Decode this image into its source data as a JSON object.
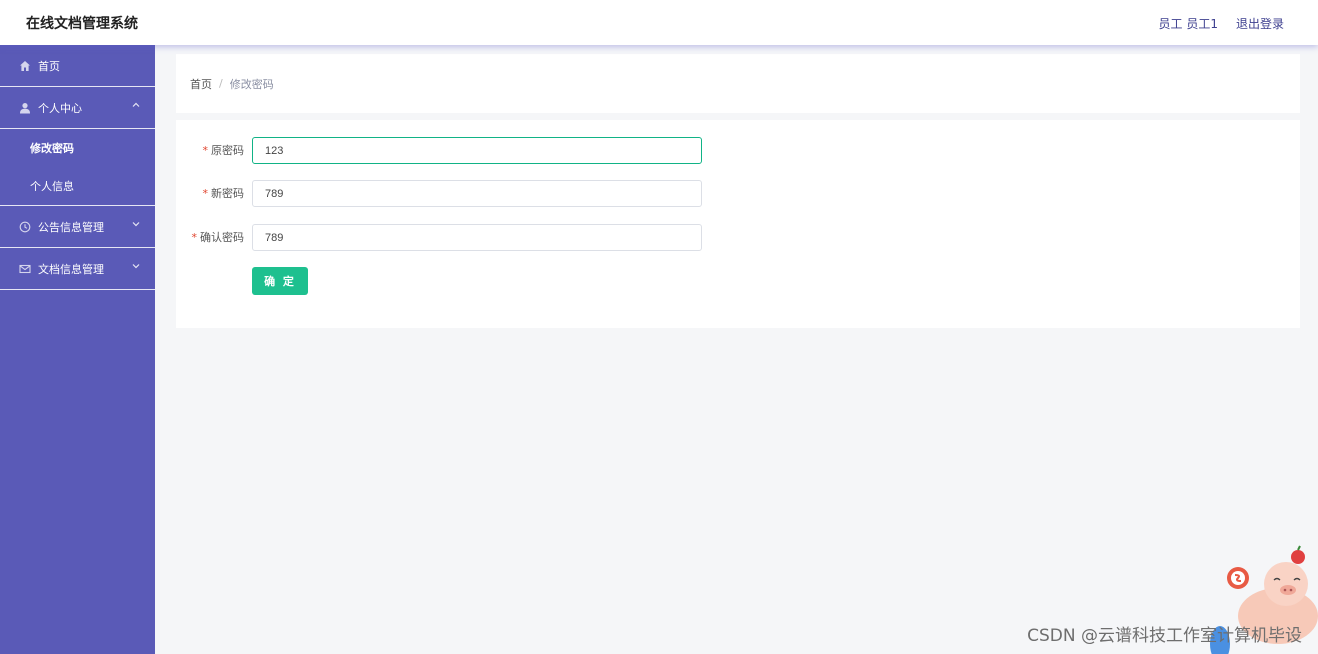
{
  "header": {
    "app_title": "在线文档管理系统",
    "user_label": "员工 员工1",
    "logout_label": "退出登录"
  },
  "sidebar": {
    "home": {
      "label": "首页",
      "icon": "home-icon"
    },
    "personal_center": {
      "label": "个人中心",
      "icon": "user-icon",
      "expanded": true,
      "children": [
        {
          "label": "修改密码",
          "active": true
        },
        {
          "label": "个人信息",
          "active": false
        }
      ]
    },
    "notice_mgmt": {
      "label": "公告信息管理",
      "icon": "clock-icon"
    },
    "doc_mgmt": {
      "label": "文档信息管理",
      "icon": "mail-icon"
    }
  },
  "breadcrumb": {
    "home": "首页",
    "separator": "/",
    "current": "修改密码"
  },
  "form": {
    "old_password": {
      "label": "原密码",
      "value": "123"
    },
    "new_password": {
      "label": "新密码",
      "value": "789"
    },
    "confirm_password": {
      "label": "确认密码",
      "value": "789"
    },
    "submit_label": "确 定",
    "required_mark": "*"
  },
  "watermark": "CSDN @云谱科技工作室计算机毕设",
  "colors": {
    "sidebar_bg": "#5a5ab7",
    "accent_green": "#1ec08f",
    "focus_border": "#11b386",
    "required_red": "#e0452f"
  }
}
